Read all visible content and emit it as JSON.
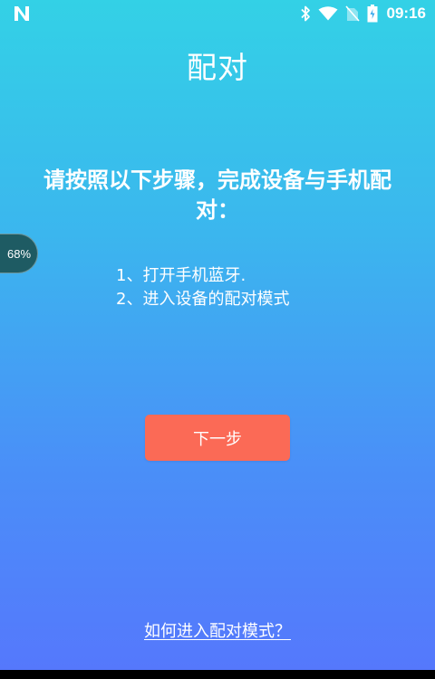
{
  "status_bar": {
    "time": "09:16",
    "icons": [
      "n-notification-icon",
      "bluetooth-icon",
      "wifi-icon",
      "no-sim-icon",
      "battery-icon"
    ]
  },
  "header": {
    "title": "配对"
  },
  "main": {
    "headline": "请按照以下步骤，完成设备与手机配对：",
    "steps": [
      "1、打开手机蓝牙.",
      "2、进入设备的配对模式"
    ],
    "next_button_label": "下一步",
    "help_link_label": "如何进入配对模式？"
  },
  "floating_badge": {
    "label": "68%"
  },
  "colors": {
    "gradient_top": "#33d1e6",
    "gradient_bottom": "#5578fc",
    "button": "#fb6a56",
    "badge": "#1e5b63"
  }
}
